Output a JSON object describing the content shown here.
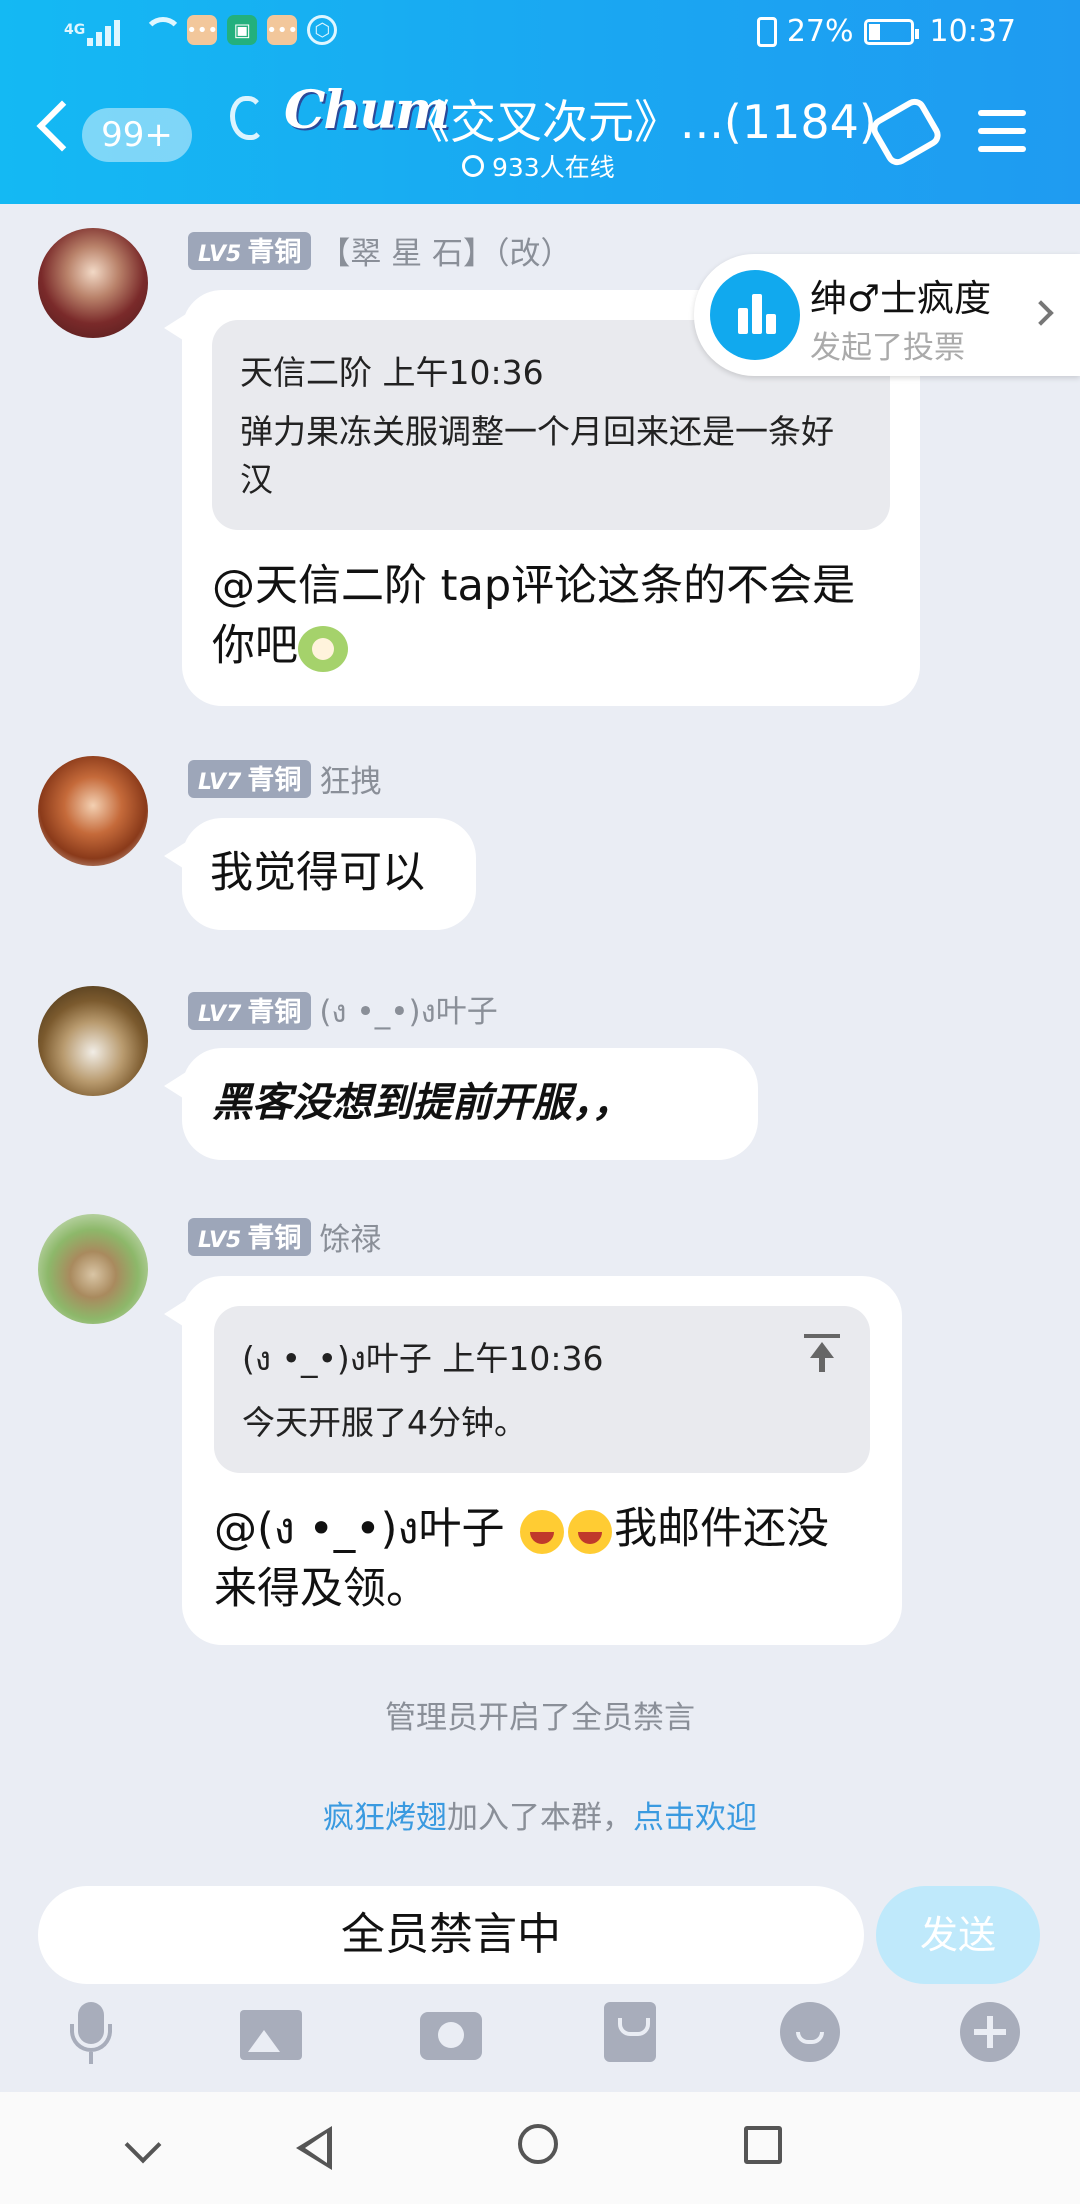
{
  "status_bar": {
    "network": "4G",
    "battery_percent": "27%",
    "battery_level": 0.27,
    "time": "10:37",
    "icons": [
      "signal-icon",
      "wifi-icon",
      "chat-app-icon",
      "shield-app-icon",
      "chat-app-icon",
      "hexagon-app-icon",
      "vibrate-icon",
      "battery-icon"
    ]
  },
  "header": {
    "unread_count": "99+",
    "brand_logo_text": "Chum",
    "group_title": "《交叉次元》...(1184)",
    "online_count": "933人在线"
  },
  "vote_card": {
    "user": "绅♂士疯度",
    "action": "发起了投票"
  },
  "messages": [
    {
      "level": "LV5",
      "rank": "青铜",
      "sender": "【翠 星 石】（改）",
      "quote": {
        "author": "天信二阶",
        "time": "上午10:36",
        "text": "弹力果冻关服调整一个月回来还是一条好汉"
      },
      "text": "@天信二阶 tap评论这条的不会是你吧"
    },
    {
      "level": "LV7",
      "rank": "青铜",
      "sender": "狂拽",
      "text": "我觉得可以"
    },
    {
      "level": "LV7",
      "rank": "青铜",
      "sender": "(ง •_•)ง叶子",
      "text": "黑客没想到提前开服，，"
    },
    {
      "level": "LV5",
      "rank": "青铜",
      "sender": "馀禄",
      "quote": {
        "author": "(ง •_•)ง叶子",
        "time": "上午10:36",
        "text": "今天开服了4分钟。"
      },
      "text_prefix": "@(ง •_•)ง叶子 ",
      "text_suffix": "我邮件还没来得及领。"
    }
  ],
  "system": {
    "mute_notice": "管理员开启了全员禁言",
    "join_user": "疯狂烤翅",
    "join_text": "加入了本群，",
    "welcome_link": "点击欢迎"
  },
  "input": {
    "placeholder": "全员禁言中",
    "send_label": "发送"
  },
  "colors": {
    "header_gradient_start": "#14b9f3",
    "header_gradient_end": "#1f9bf1",
    "page_background": "#eaedf4",
    "level_badge": "#9da6b9",
    "link": "#3a9ae0",
    "send_disabled": "#bfe9fb"
  }
}
